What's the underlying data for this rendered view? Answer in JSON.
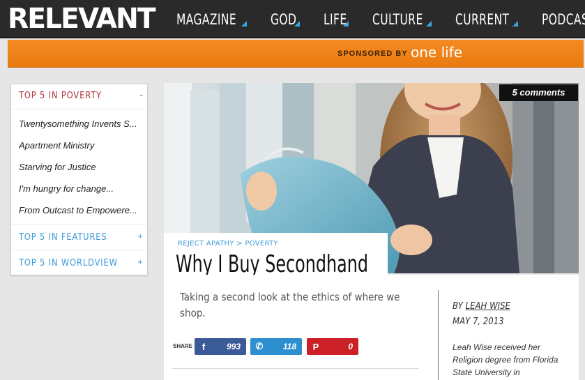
{
  "header": {
    "logo": "RELEVANT",
    "nav": [
      {
        "label": "MAGAZINE",
        "caret": true
      },
      {
        "label": "GOD",
        "caret": true
      },
      {
        "label": "LIFE",
        "caret": true
      },
      {
        "label": "CULTURE",
        "caret": true
      },
      {
        "label": "CURRENT",
        "caret": true
      },
      {
        "label": "PODCAST",
        "caret": false
      }
    ]
  },
  "sponsor": {
    "text": "SPONSORED BY",
    "brand": "one life"
  },
  "sidebar": {
    "section1": {
      "title": "TOP 5 IN POVERTY",
      "toggle": "-"
    },
    "items": [
      "Twentysomething Invents S...",
      "Apartment Ministry",
      "Starving for Justice",
      "I'm hungry for change...",
      "From Outcast to Empowere..."
    ],
    "section2": {
      "title": "TOP 5 IN FEATURES",
      "toggle": "+"
    },
    "section3": {
      "title": "TOP 5 IN WORLDVIEW",
      "toggle": "+"
    }
  },
  "article": {
    "comments": "5 comments",
    "breadcrumb": {
      "first": "REJECT APATHY",
      "sep": ">",
      "second": "POVERTY"
    },
    "title": "Why I Buy Secondhand",
    "deck": "Taking a second look at the ethics of where we shop.",
    "share": {
      "label": "SHARE",
      "facebook": {
        "icon": "f",
        "count": "993"
      },
      "twitter": {
        "icon": "✆",
        "count": "118"
      },
      "pinterest": {
        "icon": "P",
        "count": "0"
      }
    },
    "byline_prefix": "BY",
    "author": "LEAH WISE",
    "date": "MAY 7, 2013",
    "bio": "Leah Wise received her Religion degree from Florida State University in"
  },
  "colors": {
    "header_bg": "#2a2a2a",
    "sponsor_orange": "#f58a22",
    "poverty_red": "#b0333a",
    "accent_blue": "#3a9ad9",
    "facebook": "#3b5b98",
    "twitter": "#2d8fd0",
    "pinterest": "#cb2027"
  }
}
